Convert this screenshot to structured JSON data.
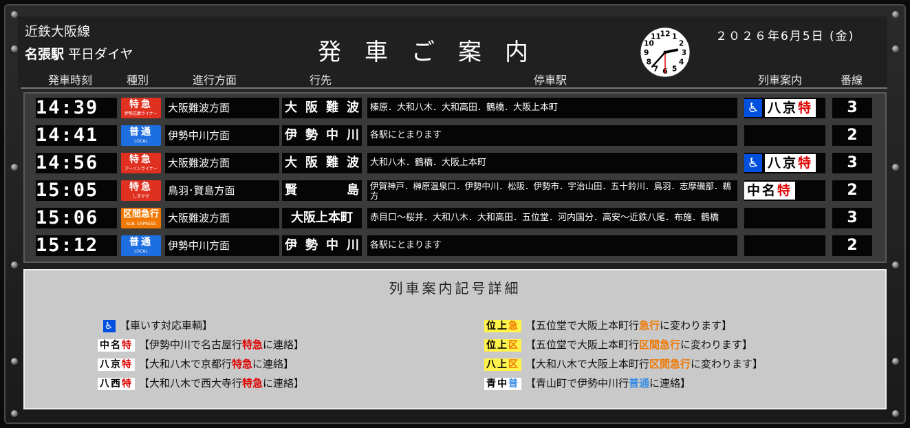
{
  "header": {
    "line_name": "近鉄大阪線",
    "station_name": "名張駅",
    "schedule": "平日ダイヤ",
    "board_title": "発車ご案内",
    "date": "２０２６年6月5日 (金)",
    "clock": {
      "hour": 14,
      "minute": 37,
      "second": 30
    }
  },
  "columns": {
    "time": "発車時刻",
    "type": "種別",
    "direction": "進行方面",
    "destination": "行先",
    "stops": "停車駅",
    "guide": "列車案内",
    "track": "番線"
  },
  "trains": [
    {
      "time": "14:39",
      "type_main": "特急",
      "type_sub": "伊勢志摩ライナー",
      "type_color": "#e03020",
      "direction": "大阪難波方面",
      "destination": "大阪難波",
      "stops": "榛原．大和八木．大和高田．鶴橋．大阪上本町",
      "wheelchair": true,
      "guide_a": "八京",
      "guide_b": "特",
      "track": "3"
    },
    {
      "time": "14:41",
      "type_main": "普通",
      "type_sub": "LOCAL",
      "type_color": "#1d6ee0",
      "direction": "伊勢中川方面",
      "destination": "伊勢中川",
      "stops": "各駅にとまります",
      "wheelchair": false,
      "guide_a": "",
      "guide_b": "",
      "track": "2"
    },
    {
      "time": "14:56",
      "type_main": "特急",
      "type_sub": "アーバンライナー",
      "type_color": "#e03020",
      "direction": "大阪難波方面",
      "destination": "大阪難波",
      "stops": "大和八木．鶴橋．大阪上本町",
      "wheelchair": true,
      "guide_a": "八京",
      "guide_b": "特",
      "track": "3"
    },
    {
      "time": "15:05",
      "type_main": "特急",
      "type_sub": "しまかぜ",
      "type_color": "#e03020",
      "direction": "鳥羽･賢島方面",
      "destination": "賢島",
      "stops": "伊賀神戸．榊原温泉口．伊勢中川．松阪．伊勢市．宇治山田．五十鈴川．鳥羽．志摩磯部．鵜方",
      "wheelchair": false,
      "guide_a": "中名",
      "guide_b": "特",
      "track": "2"
    },
    {
      "time": "15:06",
      "type_main": "区間急行",
      "type_sub": "SUB. EXPRESS",
      "type_color": "#f07800",
      "direction": "大阪難波方面",
      "destination": "大阪上本町",
      "stops": "赤目口～桜井．大和八木．大和高田．五位堂．河内国分．高安～近鉄八尾．布施．鶴橋",
      "wheelchair": false,
      "guide_a": "",
      "guide_b": "",
      "track": "3"
    },
    {
      "time": "15:12",
      "type_main": "普通",
      "type_sub": "LOCAL",
      "type_color": "#1d6ee0",
      "direction": "伊勢中川方面",
      "destination": "伊勢中川",
      "stops": "各駅にとまります",
      "wheelchair": false,
      "guide_a": "",
      "guide_b": "",
      "track": "2"
    }
  ],
  "legend": {
    "title": "列車案内記号詳細",
    "left": [
      {
        "chip": "♿",
        "chip_style": "blue",
        "text_a": "【車いす対応車輌】",
        "hl": "",
        "hl_style": "",
        "text_b": ""
      },
      {
        "chip": "中名",
        "chip_mark": "特",
        "chip_style": "white",
        "text_a": "【伊勢中川で名古屋行",
        "hl": "特急",
        "hl_style": "r",
        "text_b": "に連絡】"
      },
      {
        "chip": "八京",
        "chip_mark": "特",
        "chip_style": "white",
        "text_a": "【大和八木で京都行",
        "hl": "特急",
        "hl_style": "r",
        "text_b": "に連絡】"
      },
      {
        "chip": "八西",
        "chip_mark": "特",
        "chip_style": "white",
        "text_a": "【大和八木で西大寺行",
        "hl": "特急",
        "hl_style": "r",
        "text_b": "に連絡】"
      }
    ],
    "right": [
      {
        "chip": "位上",
        "chip_mark": "急",
        "chip_style": "yellow",
        "text_a": "【五位堂で大阪上本町行",
        "hl": "急行",
        "hl_style": "o",
        "text_b": "に変わります】"
      },
      {
        "chip": "位上",
        "chip_mark": "区",
        "chip_style": "yellow",
        "text_a": "【五位堂で大阪上本町行",
        "hl": "区間急行",
        "hl_style": "o",
        "text_b": "に変わります】"
      },
      {
        "chip": "八上",
        "chip_mark": "区",
        "chip_style": "yellow",
        "text_a": "【大和八木で大阪上本町行",
        "hl": "区間急行",
        "hl_style": "o",
        "text_b": "に変わります】"
      },
      {
        "chip": "青中",
        "chip_mark": "普",
        "chip_style": "white",
        "text_a": "【青山町で伊勢中川行",
        "hl": "普通",
        "hl_style": "b",
        "text_b": "に連絡】"
      }
    ]
  }
}
